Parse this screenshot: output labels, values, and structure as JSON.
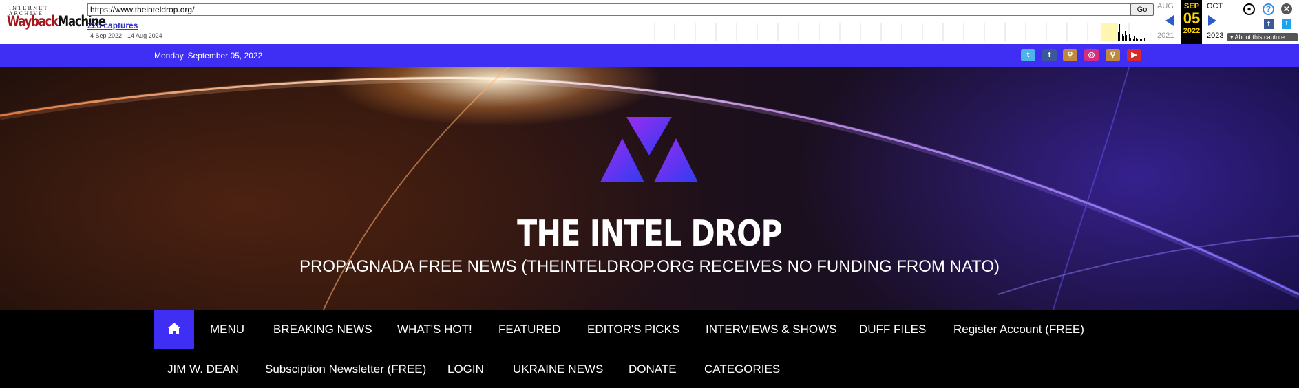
{
  "wayback": {
    "logo_top": "INTERNET ARCHIVE",
    "logo_way": "Wayback",
    "logo_machine": "Machine",
    "url": "https://www.theinteldrop.org/",
    "go_label": "Go",
    "captures_label": "226 captures",
    "date_range": "4 Sep 2022 - 14 Aug 2024",
    "prev_month": "AUG",
    "prev_year": "2021",
    "cur_month": "SEP",
    "cur_day": "05",
    "cur_year": "2022",
    "next_month": "OCT",
    "next_year": "2023",
    "about_label": "About this capture",
    "icons": [
      "user-icon",
      "help-icon",
      "close-icon",
      "facebook-icon",
      "twitter-icon"
    ]
  },
  "topbar": {
    "date": "Monday, September 05, 2022",
    "social": [
      {
        "icon": "twitter-icon",
        "glyph": "t",
        "color": "#4fb3ea"
      },
      {
        "icon": "facebook-icon",
        "glyph": "f",
        "color": "#3b5998"
      },
      {
        "icon": "search-icon",
        "glyph": "⚲",
        "color": "#c08a3a"
      },
      {
        "icon": "instagram-icon",
        "glyph": "◎",
        "color": "#d62e7e"
      },
      {
        "icon": "search-icon",
        "glyph": "⚲",
        "color": "#c08a3a"
      },
      {
        "icon": "youtube-icon",
        "glyph": "▶",
        "color": "#d62b2b"
      }
    ],
    "bar_color": "#3f2ef4"
  },
  "hero": {
    "title": "THE INTEL DROP",
    "subtitle": "PROPAGNADA FREE NEWS (THEINTELDROP.ORG RECEIVES NO FUNDING FROM NATO)"
  },
  "nav": {
    "home_icon": "home-icon",
    "row1": [
      "MENU",
      "BREAKING NEWS",
      "WHAT'S HOT!",
      "FEATURED",
      "EDITOR'S PICKS",
      "INTERVIEWS & SHOWS",
      "DUFF FILES",
      "Register Account (FREE)"
    ],
    "row2": [
      "JIM W. DEAN",
      "Subsciption Newsletter (FREE)",
      "LOGIN",
      "UKRAINE NEWS",
      "DONATE",
      "CATEGORIES"
    ]
  }
}
